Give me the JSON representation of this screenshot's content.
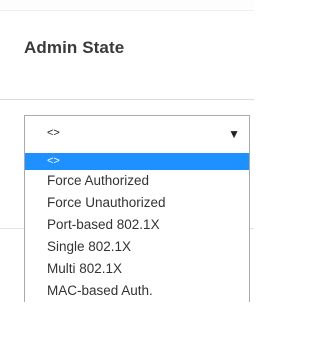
{
  "column": {
    "title": "Admin State"
  },
  "select": {
    "value": "<>",
    "caret": "▼",
    "options": [
      "<>",
      "Force Authorized",
      "Force Unauthorized",
      "Port-based 802.1X",
      "Single 802.1X",
      "Multi 802.1X",
      "MAC-based Auth."
    ],
    "highlighted_index": 0
  },
  "colors": {
    "highlight": "#1e90ff",
    "border": "#aaaaaa",
    "text": "#333333"
  }
}
